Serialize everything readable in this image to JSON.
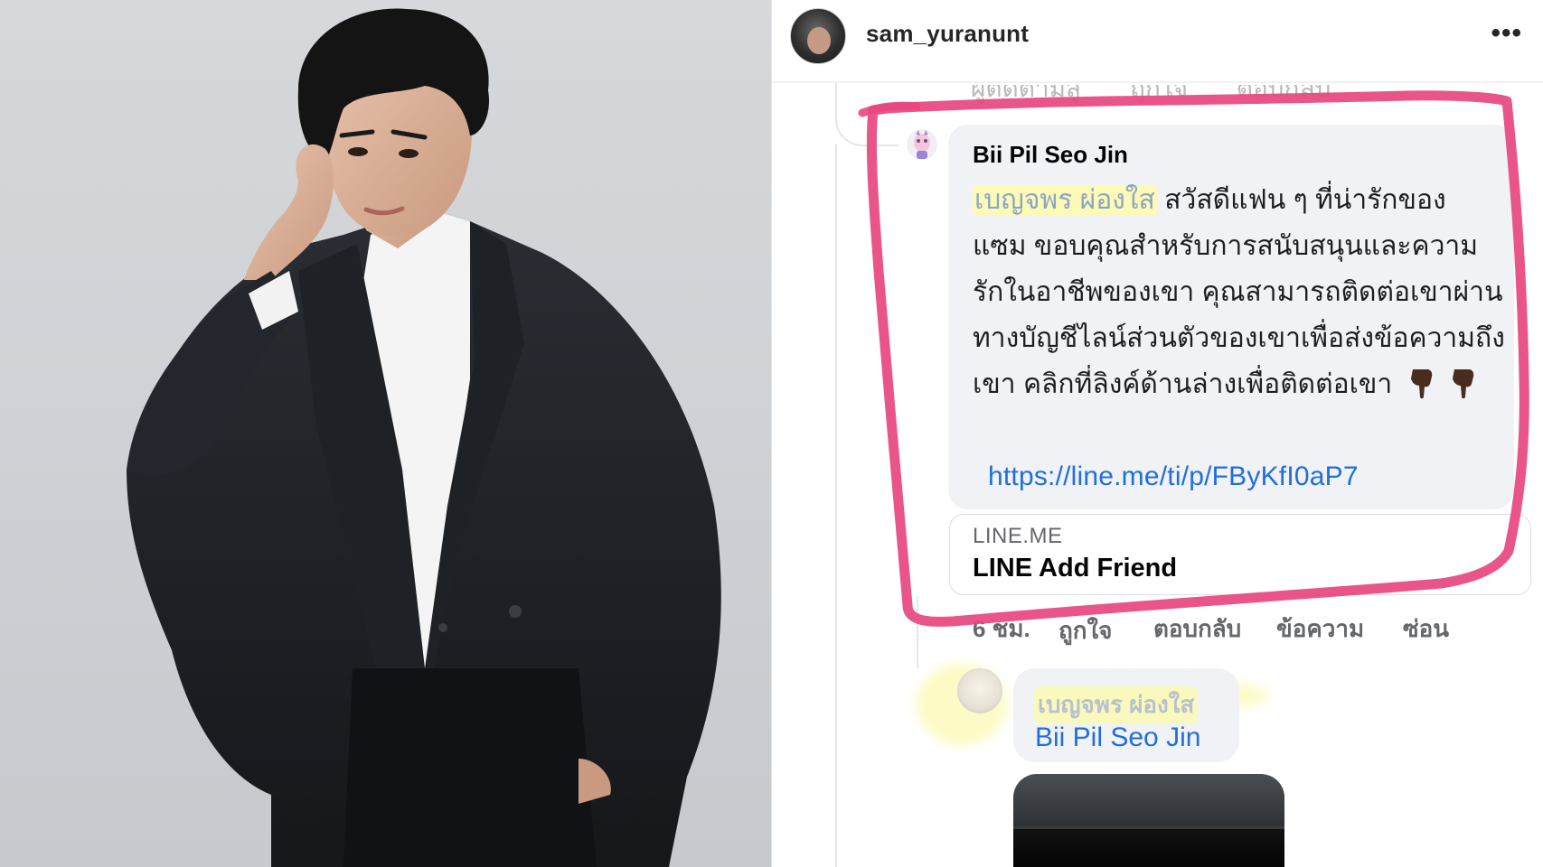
{
  "post": {
    "username": "sam_yuranunt",
    "more_icon": "•••"
  },
  "top_faded_actions": [
    "ผู้ติดตามสู",
    "ถูกใจ",
    "ตอบกลับ"
  ],
  "comment": {
    "author": "Bii Pil Seo Jin",
    "mention": "เบญจพร ผ่องใส",
    "text_line1": "สวัสดีแฟน ๆ ที่น่ารักของ",
    "text_rest": "แซม  ขอบคุณสำหรับการสนับสนุนและความรักในอาชีพของเขา คุณสามารถติดต่อเขาผ่านทางบัญชีไลน์ส่วนตัวของเขาเพื่อส่งข้อความถึงเขา คลิกที่ลิงค์ด้านล่างเพื่อติดต่อเขา",
    "link": "https://line.me/ti/p/FByKfI0aP7",
    "emoji": "backhand-index-pointing-down"
  },
  "link_preview": {
    "domain": "LINE.ME",
    "title": "LINE Add Friend"
  },
  "comment_actions": {
    "time": "6 ชม.",
    "like": "ถูกใจ",
    "reply": "ตอบกลับ",
    "message": "ข้อความ",
    "hide": "ซ่อน"
  },
  "reply": {
    "mention": "เบญจพร ผ่องใส",
    "name": "Bii Pil Seo Jin"
  },
  "colors": {
    "highlight": "#e8477f",
    "link": "#216fdb",
    "bubble": "#f0f2f5"
  }
}
